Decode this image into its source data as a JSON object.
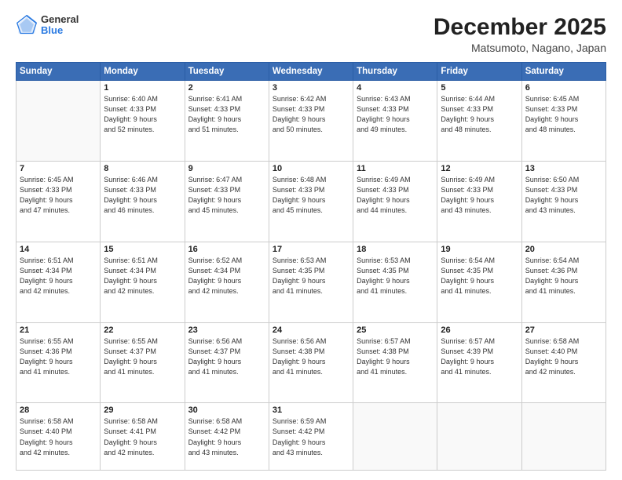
{
  "header": {
    "logo": {
      "general": "General",
      "blue": "Blue"
    },
    "title": "December 2025",
    "location": "Matsumoto, Nagano, Japan"
  },
  "calendar": {
    "days_of_week": [
      "Sunday",
      "Monday",
      "Tuesday",
      "Wednesday",
      "Thursday",
      "Friday",
      "Saturday"
    ],
    "weeks": [
      [
        {
          "day": "",
          "info": ""
        },
        {
          "day": "1",
          "info": "Sunrise: 6:40 AM\nSunset: 4:33 PM\nDaylight: 9 hours\nand 52 minutes."
        },
        {
          "day": "2",
          "info": "Sunrise: 6:41 AM\nSunset: 4:33 PM\nDaylight: 9 hours\nand 51 minutes."
        },
        {
          "day": "3",
          "info": "Sunrise: 6:42 AM\nSunset: 4:33 PM\nDaylight: 9 hours\nand 50 minutes."
        },
        {
          "day": "4",
          "info": "Sunrise: 6:43 AM\nSunset: 4:33 PM\nDaylight: 9 hours\nand 49 minutes."
        },
        {
          "day": "5",
          "info": "Sunrise: 6:44 AM\nSunset: 4:33 PM\nDaylight: 9 hours\nand 48 minutes."
        },
        {
          "day": "6",
          "info": "Sunrise: 6:45 AM\nSunset: 4:33 PM\nDaylight: 9 hours\nand 48 minutes."
        }
      ],
      [
        {
          "day": "7",
          "info": "Sunrise: 6:45 AM\nSunset: 4:33 PM\nDaylight: 9 hours\nand 47 minutes."
        },
        {
          "day": "8",
          "info": "Sunrise: 6:46 AM\nSunset: 4:33 PM\nDaylight: 9 hours\nand 46 minutes."
        },
        {
          "day": "9",
          "info": "Sunrise: 6:47 AM\nSunset: 4:33 PM\nDaylight: 9 hours\nand 45 minutes."
        },
        {
          "day": "10",
          "info": "Sunrise: 6:48 AM\nSunset: 4:33 PM\nDaylight: 9 hours\nand 45 minutes."
        },
        {
          "day": "11",
          "info": "Sunrise: 6:49 AM\nSunset: 4:33 PM\nDaylight: 9 hours\nand 44 minutes."
        },
        {
          "day": "12",
          "info": "Sunrise: 6:49 AM\nSunset: 4:33 PM\nDaylight: 9 hours\nand 43 minutes."
        },
        {
          "day": "13",
          "info": "Sunrise: 6:50 AM\nSunset: 4:33 PM\nDaylight: 9 hours\nand 43 minutes."
        }
      ],
      [
        {
          "day": "14",
          "info": "Sunrise: 6:51 AM\nSunset: 4:34 PM\nDaylight: 9 hours\nand 42 minutes."
        },
        {
          "day": "15",
          "info": "Sunrise: 6:51 AM\nSunset: 4:34 PM\nDaylight: 9 hours\nand 42 minutes."
        },
        {
          "day": "16",
          "info": "Sunrise: 6:52 AM\nSunset: 4:34 PM\nDaylight: 9 hours\nand 42 minutes."
        },
        {
          "day": "17",
          "info": "Sunrise: 6:53 AM\nSunset: 4:35 PM\nDaylight: 9 hours\nand 41 minutes."
        },
        {
          "day": "18",
          "info": "Sunrise: 6:53 AM\nSunset: 4:35 PM\nDaylight: 9 hours\nand 41 minutes."
        },
        {
          "day": "19",
          "info": "Sunrise: 6:54 AM\nSunset: 4:35 PM\nDaylight: 9 hours\nand 41 minutes."
        },
        {
          "day": "20",
          "info": "Sunrise: 6:54 AM\nSunset: 4:36 PM\nDaylight: 9 hours\nand 41 minutes."
        }
      ],
      [
        {
          "day": "21",
          "info": "Sunrise: 6:55 AM\nSunset: 4:36 PM\nDaylight: 9 hours\nand 41 minutes."
        },
        {
          "day": "22",
          "info": "Sunrise: 6:55 AM\nSunset: 4:37 PM\nDaylight: 9 hours\nand 41 minutes."
        },
        {
          "day": "23",
          "info": "Sunrise: 6:56 AM\nSunset: 4:37 PM\nDaylight: 9 hours\nand 41 minutes."
        },
        {
          "day": "24",
          "info": "Sunrise: 6:56 AM\nSunset: 4:38 PM\nDaylight: 9 hours\nand 41 minutes."
        },
        {
          "day": "25",
          "info": "Sunrise: 6:57 AM\nSunset: 4:38 PM\nDaylight: 9 hours\nand 41 minutes."
        },
        {
          "day": "26",
          "info": "Sunrise: 6:57 AM\nSunset: 4:39 PM\nDaylight: 9 hours\nand 41 minutes."
        },
        {
          "day": "27",
          "info": "Sunrise: 6:58 AM\nSunset: 4:40 PM\nDaylight: 9 hours\nand 42 minutes."
        }
      ],
      [
        {
          "day": "28",
          "info": "Sunrise: 6:58 AM\nSunset: 4:40 PM\nDaylight: 9 hours\nand 42 minutes."
        },
        {
          "day": "29",
          "info": "Sunrise: 6:58 AM\nSunset: 4:41 PM\nDaylight: 9 hours\nand 42 minutes."
        },
        {
          "day": "30",
          "info": "Sunrise: 6:58 AM\nSunset: 4:42 PM\nDaylight: 9 hours\nand 43 minutes."
        },
        {
          "day": "31",
          "info": "Sunrise: 6:59 AM\nSunset: 4:42 PM\nDaylight: 9 hours\nand 43 minutes."
        },
        {
          "day": "",
          "info": ""
        },
        {
          "day": "",
          "info": ""
        },
        {
          "day": "",
          "info": ""
        }
      ]
    ]
  }
}
